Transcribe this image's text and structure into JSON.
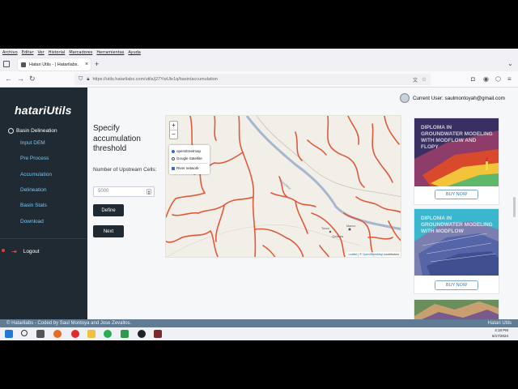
{
  "browser": {
    "menu": [
      "Archivo",
      "Editar",
      "Ver",
      "Historial",
      "Marcadores",
      "Herramientas",
      "Ayuda"
    ],
    "tab_title": "Hatari Utils - | Hatarilabs.",
    "url": "https://utils.hatarilabs.com/utils/j27YwUle1q/basin/accumulation"
  },
  "sidebar": {
    "logo": "hatariUtils",
    "section": "Basin Delineation",
    "items": [
      {
        "label": "Input DEM"
      },
      {
        "label": "Pre Process"
      },
      {
        "label": "Accumulation"
      },
      {
        "label": "Delineation"
      },
      {
        "label": "Basin Stats"
      },
      {
        "label": "Download"
      }
    ],
    "logout": "Logout"
  },
  "form": {
    "title": "Specify accumulation threshold",
    "cells_label": "Number of Upstream Cells:",
    "cells_value": "5000",
    "define_label": "Define",
    "next_label": "Next"
  },
  "map": {
    "zoom_in": "+",
    "zoom_out": "−",
    "layers": {
      "base": [
        "openstreetmap",
        "Google Satellite"
      ],
      "selected_base": "openstreetmap",
      "overlay": "River network",
      "overlay_checked": true
    },
    "attribution_leaflet": "Leaflet",
    "attribution_osm": "OpenStreetMap",
    "attribution_rest": "contributors",
    "place_labels": [
      "Ccochacc",
      "Tocco",
      "Manco",
      "Quillaba"
    ],
    "river_color": "#e05a3a"
  },
  "user": {
    "label": "Current User: saulmontoyah@gmail.com"
  },
  "ads": [
    {
      "image_text": "DIPLOMA IN GROUNDWATER MODELING WITH MODFLOW AND FLOPY",
      "button": "BUY NOW"
    },
    {
      "image_text": "DIPLOMA IN GROUNDWATER MODELING WITH MODFLOW",
      "button": "BUY NOW"
    },
    {
      "image_text": "",
      "button": ""
    }
  ],
  "footer": {
    "left": "© Hatarilabs - Coded by Saul Montoya and Jose Zevallos.",
    "right": "Hatari Utils"
  },
  "taskbar": {
    "time": "4:18 PM",
    "date": "6/17/2024"
  }
}
